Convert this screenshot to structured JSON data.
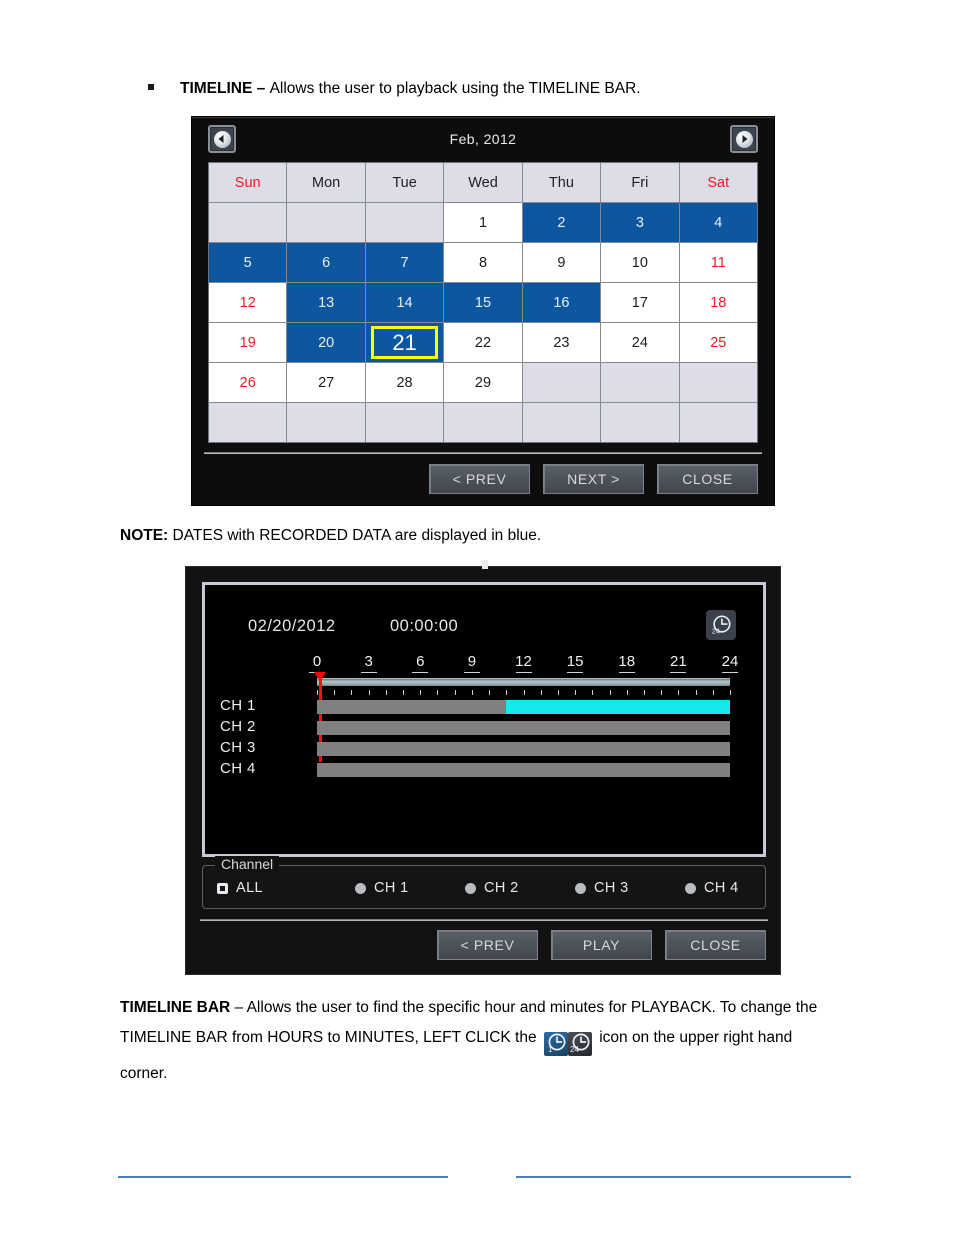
{
  "doc": {
    "bullet_title": "TIMELINE – ",
    "bullet_text": "Allows the user to playback using the TIMELINE BAR.",
    "note_label": "NOTE: ",
    "note_text": "DATES with RECORDED DATA are displayed in blue.",
    "para_title": "TIMELINE BAR",
    "para_part1": " – Allows the user to find the specific hour and minutes for PLAYBACK.  To change the TIMELINE BAR from HOURS to MINUTES, LEFT CLICK the ",
    "para_part2": " icon on the upper right hand corner.",
    "icon1": "clock-1-icon",
    "icon2": "clock-24-icon"
  },
  "calendar": {
    "title": "Feb, 2012",
    "prev_icon": "arrow-left-icon",
    "next_icon": "arrow-right-icon",
    "weekdays": [
      "Sun",
      "Mon",
      "Tue",
      "Wed",
      "Thu",
      "Fri",
      "Sat"
    ],
    "weekend_columns": [
      0,
      6
    ],
    "selected_day": "21",
    "rows": [
      [
        {
          "day": "",
          "blank": true
        },
        {
          "day": "",
          "blank": true
        },
        {
          "day": "",
          "blank": true
        },
        {
          "day": "1",
          "rec": false
        },
        {
          "day": "2",
          "rec": true
        },
        {
          "day": "3",
          "rec": true
        },
        {
          "day": "4",
          "rec": true
        }
      ],
      [
        {
          "day": "5",
          "rec": true
        },
        {
          "day": "6",
          "rec": true
        },
        {
          "day": "7",
          "rec": true
        },
        {
          "day": "8",
          "rec": false
        },
        {
          "day": "9",
          "rec": false
        },
        {
          "day": "10",
          "rec": false
        },
        {
          "day": "11",
          "rec": false
        }
      ],
      [
        {
          "day": "12",
          "rec": false
        },
        {
          "day": "13",
          "rec": true
        },
        {
          "day": "14",
          "rec": true
        },
        {
          "day": "15",
          "rec": true
        },
        {
          "day": "16",
          "rec": true
        },
        {
          "day": "17",
          "rec": false
        },
        {
          "day": "18",
          "rec": false
        }
      ],
      [
        {
          "day": "19",
          "rec": false
        },
        {
          "day": "20",
          "rec": true
        },
        {
          "day": "21",
          "rec": true,
          "selected": true
        },
        {
          "day": "22",
          "rec": false
        },
        {
          "day": "23",
          "rec": false
        },
        {
          "day": "24",
          "rec": false
        },
        {
          "day": "25",
          "rec": false
        }
      ],
      [
        {
          "day": "26",
          "rec": false
        },
        {
          "day": "27",
          "rec": false
        },
        {
          "day": "28",
          "rec": false
        },
        {
          "day": "29",
          "rec": false
        },
        {
          "day": "",
          "blank": true
        },
        {
          "day": "",
          "blank": true
        },
        {
          "day": "",
          "blank": true
        }
      ],
      [
        {
          "day": "",
          "blank": true
        },
        {
          "day": "",
          "blank": true
        },
        {
          "day": "",
          "blank": true
        },
        {
          "day": "",
          "blank": true
        },
        {
          "day": "",
          "blank": true
        },
        {
          "day": "",
          "blank": true
        },
        {
          "day": "",
          "blank": true
        }
      ]
    ],
    "buttons": {
      "prev": "< PREV",
      "next": "NEXT >",
      "close": "CLOSE"
    }
  },
  "timeline": {
    "date": "02/20/2012",
    "time": "00:00:00",
    "clock_icon": "clock-24-icon",
    "clock_icon_label": "24",
    "ruler_labels": [
      "0",
      "3",
      "6",
      "9",
      "12",
      "15",
      "18",
      "21",
      "24"
    ],
    "ruler_min": 0,
    "ruler_max": 24,
    "playhead_hour": 0,
    "channels": [
      {
        "name": "CH 1",
        "recorded_start": 11,
        "recorded_end": 24
      },
      {
        "name": "CH 2",
        "recorded_start": null,
        "recorded_end": null
      },
      {
        "name": "CH 3",
        "recorded_start": null,
        "recorded_end": null
      },
      {
        "name": "CH 4",
        "recorded_start": null,
        "recorded_end": null
      }
    ],
    "channel_group_label": "Channel",
    "channel_options": [
      {
        "label": "ALL",
        "selected": true
      },
      {
        "label": "CH 1",
        "selected": false
      },
      {
        "label": "CH 2",
        "selected": false
      },
      {
        "label": "CH 3",
        "selected": false
      },
      {
        "label": "CH 4",
        "selected": false
      }
    ],
    "buttons": {
      "prev": "< PREV",
      "play": "PLAY",
      "close": "CLOSE"
    }
  },
  "colors": {
    "recorded_blue": "#0d56a0",
    "selected_yellow": "#ffff00",
    "weekend_red": "#ed1c24",
    "playback_cyan": "#16e9ec",
    "playhead_red": "#ff0000",
    "footer_rule": "#4a7ebb"
  }
}
